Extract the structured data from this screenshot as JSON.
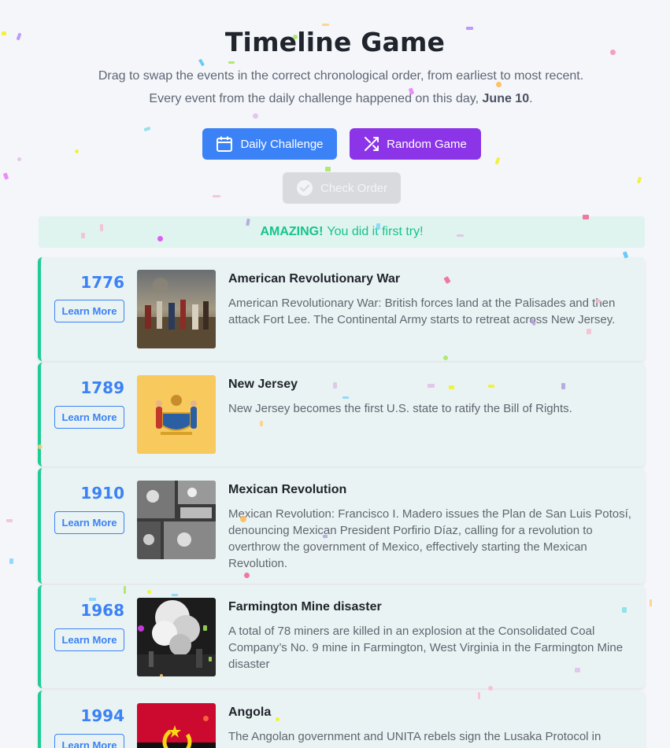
{
  "header": {
    "title": "Timeline Game",
    "subtitle_line1": "Drag to swap the events in the correct chronological order, from earliest to most recent.",
    "subtitle_line2_prefix": "Every event from the daily challenge happened on this day,",
    "subtitle_line2_date": "June 10",
    "subtitle_line2_suffix": "."
  },
  "buttons": {
    "daily_label": "Daily Challenge",
    "random_label": "Random Game",
    "check_label": "Check Order"
  },
  "banner": {
    "strong": "AMAZING!",
    "text": "You did it first try!"
  },
  "events": [
    {
      "year": "1776",
      "learn_more": "Learn More",
      "title": "American Revolutionary War",
      "description": "American Revolutionary War: British forces land at the Palisades and then attack Fort Lee. The Continental Army starts to retreat across New Jersey."
    },
    {
      "year": "1789",
      "learn_more": "Learn More",
      "title": "New Jersey",
      "description": "New Jersey becomes the first U.S. state to ratify the Bill of Rights."
    },
    {
      "year": "1910",
      "learn_more": "Learn More",
      "title": "Mexican Revolution",
      "description": "Mexican Revolution: Francisco I. Madero issues the Plan de San Luis Potosí, denouncing Mexican President Porfirio Díaz, calling for a revolution to overthrow the government of Mexico, effectively starting the Mexican Revolution."
    },
    {
      "year": "1968",
      "learn_more": "Learn More",
      "title": "Farmington Mine disaster",
      "description": "A total of 78 miners are killed in an explosion at the Consolidated Coal Company’s No. 9 mine in Farmington, West Virginia in the Farmington Mine disaster"
    },
    {
      "year": "1994",
      "learn_more": "Learn More",
      "title": "Angola",
      "description": "The Angolan government and UNITA rebels sign the Lusaka Protocol in"
    }
  ],
  "colors": {
    "primary_blue": "#3b82f6",
    "random_purple": "#8b34e8",
    "success_green": "#1fcc93",
    "banner_bg": "#dff3ef",
    "card_bg": "#e9f3f3"
  },
  "icons": {
    "daily": "calendar-icon",
    "random": "shuffle-icon",
    "check": "check-circle-icon"
  }
}
